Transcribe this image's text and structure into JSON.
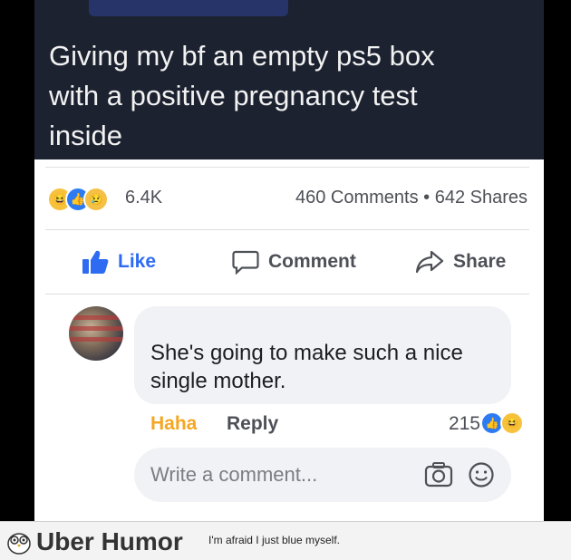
{
  "post": {
    "text": "Giving my bf an empty ps5 box\nwith a positive pregnancy test\ninside"
  },
  "reactions": {
    "icons": [
      "haha-emoji",
      "like-emoji",
      "sad-emoji"
    ],
    "count": "6.4K",
    "comments_shares": "460 Comments • 642 Shares"
  },
  "actions": {
    "like_label": "Like",
    "comment_label": "Comment",
    "share_label": "Share"
  },
  "comment": {
    "text": "She's going to make such a nice\nsingle mother.",
    "haha_label": "Haha",
    "reply_label": "Reply",
    "reaction_count": "215",
    "reaction_icons": [
      "like-emoji",
      "haha-emoji"
    ]
  },
  "composer": {
    "placeholder": "Write a comment..."
  },
  "footer": {
    "brand": "Uber Humor",
    "caption": "I'm afraid I just blue myself."
  },
  "colors": {
    "header_bg": "#1c2230",
    "like_blue": "#2d6bf2",
    "haha_orange": "#f5a623"
  }
}
